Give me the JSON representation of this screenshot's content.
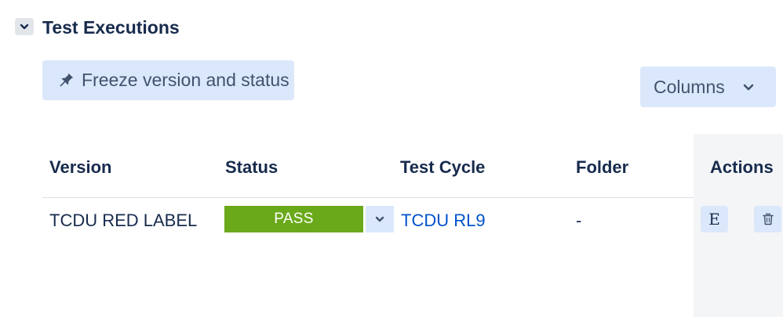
{
  "section": {
    "title": "Test Executions",
    "toggle_icon": "chevron-down-icon"
  },
  "toolbar": {
    "freeze_label": "Freeze version and status",
    "freeze_icon": "pin-icon",
    "columns_label": "Columns",
    "columns_icon": "chevron-down-icon"
  },
  "table": {
    "headers": {
      "version": "Version",
      "status": "Status",
      "test_cycle": "Test Cycle",
      "folder": "Folder",
      "actions": "Actions"
    },
    "rows": [
      {
        "version": "TCDU RED LABEL",
        "status": "PASS",
        "status_color": "#6aa91a",
        "test_cycle": "TCDU RL9",
        "folder": "-",
        "edit_label": "E",
        "delete_icon": "trash-icon"
      }
    ]
  },
  "colors": {
    "text": "#172b4d",
    "link": "#0052cc",
    "button_bg": "#dbe8fb",
    "actions_bg": "#f4f5f7"
  }
}
